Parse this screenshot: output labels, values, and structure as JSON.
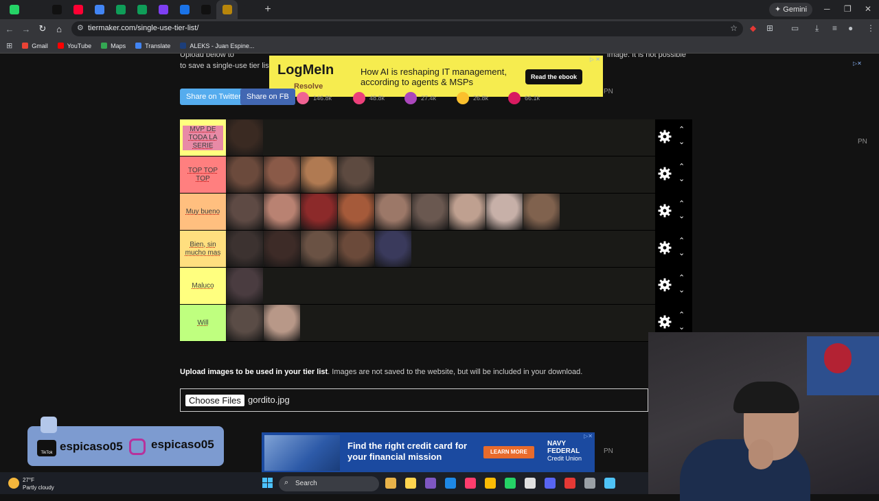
{
  "browser": {
    "url": "tiermaker.com/single-use-tier-list/",
    "gemini_label": "Gemini",
    "tab_colors": [
      "#25d366",
      "#202124",
      "#111111",
      "#ff0033",
      "#4285f4",
      "#0f9d58",
      "#0f9d58",
      "#7e3ff2",
      "#1a73e8",
      "#111111",
      "#b8860b",
      "#202124"
    ],
    "bookmarks": [
      {
        "label": "Gmail",
        "color": "#ea4335"
      },
      {
        "label": "YouTube",
        "color": "#ff0000"
      },
      {
        "label": "Maps",
        "color": "#34a853"
      },
      {
        "label": "Translate",
        "color": "#4285f4"
      },
      {
        "label": "ALEKS - Juan Espine...",
        "color": "#1c3e7a"
      }
    ]
  },
  "page": {
    "intro_line1": "Upload below to",
    "intro_line2": "to save a single-use tier lis",
    "intro_right": "image. It is not possible",
    "ad_top": {
      "logo": "LogMeIn",
      "sub": "Resolve",
      "headline": "How AI is reshaping IT management, according to agents & MSPs",
      "cta": "Read the ebook"
    },
    "share_twitter": "Share on Twitter",
    "share_fb": "Share on FB",
    "reactions": [
      {
        "count": "146.8k",
        "color": "#f06292"
      },
      {
        "count": "48.8k",
        "color": "#ec407a"
      },
      {
        "count": "27.4k",
        "color": "#ab47bc"
      },
      {
        "count": "26.8k",
        "color": "#fbc02d"
      },
      {
        "count": "66.1k",
        "color": "#d81b60"
      }
    ],
    "pn": "PN",
    "tiers": [
      {
        "label": "MVP DE TODA LA SERIE",
        "color": "#ffff7f",
        "label_style": "highlight",
        "items": [
          "#3a2a22"
        ]
      },
      {
        "label": "TOP TOP TOP",
        "color": "#ff7f7f",
        "items": [
          "#6b4a3c",
          "#8a5a48",
          "#b07a52",
          "#5d4a40"
        ]
      },
      {
        "label": "Muy bueno",
        "color": "#ffbf7f",
        "items": [
          "#5e4a44",
          "#b98272",
          "#8c2a2a",
          "#a55a3a",
          "#9c7868",
          "#6a5850",
          "#bfa090",
          "#c7b0a8",
          "#80624e"
        ]
      },
      {
        "label": "Bien, sin mucho mas",
        "color": "#ffdf7f",
        "items": [
          "#3c3230",
          "#3d2b27",
          "#6a5244",
          "#6b4a3a",
          "#3a3a5c"
        ]
      },
      {
        "label": "Maluco",
        "color": "#ffff7f",
        "items": [
          "#4a3c40"
        ]
      },
      {
        "label": "Will",
        "color": "#bfff7f",
        "items": [
          "#5a4c46",
          "#b89888"
        ]
      }
    ],
    "upload_bold": "Upload images to be used in your tier list",
    "upload_rest": ". Images are not saved to the website, but will be included in your download.",
    "choose_files": "Choose Files",
    "file_name": "gordito.jpg",
    "ad_bottom": {
      "message": "Find the right credit card for your financial mission",
      "cta": "LEARN MORE",
      "brand_line1": "NAVY",
      "brand_line2": "FEDERAL",
      "brand_line3": "Credit Union"
    },
    "social_tiktok": "espicaso05",
    "social_instagram": "espicaso05",
    "tiktok_word": "TikTok"
  },
  "taskbar": {
    "temperature": "27°F",
    "condition": "Partly cloudy",
    "search": "Search",
    "icons": [
      "#e8b34a",
      "#ffd54f",
      "#7e57c2",
      "#1e88e5",
      "#ff3d6e",
      "#fbbc05",
      "#25d366",
      "#e0e0e0",
      "#5865f2",
      "#e53935",
      "#9aa0a6",
      "#4fc3f7"
    ]
  },
  "colors": {
    "twitter": "#55acee",
    "facebook": "#4267b2",
    "gear": "#ffffff",
    "ad_top_bg": "#f6ec4f"
  }
}
